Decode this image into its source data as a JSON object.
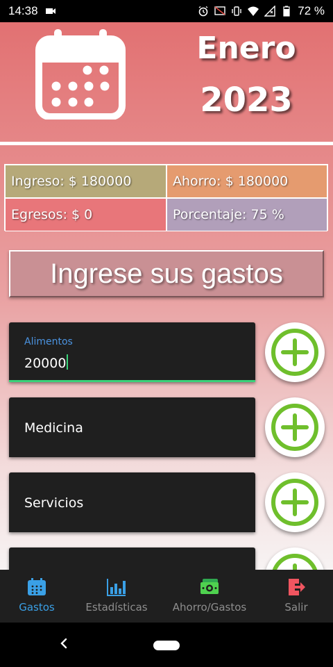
{
  "status_bar": {
    "time": "14:38",
    "battery": "72 %"
  },
  "header": {
    "month": "Enero",
    "year": "2023"
  },
  "summary": {
    "ingreso": "Ingreso: $ 180000",
    "ahorro": "Ahorro: $ 180000",
    "egresos": "Egresos: $ 0",
    "porcentaje": "Porcentaje: 75 %"
  },
  "title": "Ingrese sus gastos",
  "expenses": [
    {
      "label": "Alimentos",
      "value": "20000"
    },
    {
      "label": "Medicina"
    },
    {
      "label": "Servicios"
    }
  ],
  "bottom_nav": [
    {
      "label": "Gastos",
      "active": true
    },
    {
      "label": "Estadísticas"
    },
    {
      "label": "Ahorro/Gastos"
    },
    {
      "label": "Salir"
    }
  ],
  "colors": {
    "accent_blue": "#3aa0e6",
    "add_green": "#6fbf2c",
    "focus_green": "#3ad37a",
    "exit_red": "#f05560",
    "money_green": "#4fd14f"
  },
  "icons": {
    "calendar": "calendar-icon",
    "add": "plus-circle-icon",
    "nav": [
      "calendar-icon",
      "bar-chart-icon",
      "money-icon",
      "exit-icon"
    ]
  }
}
